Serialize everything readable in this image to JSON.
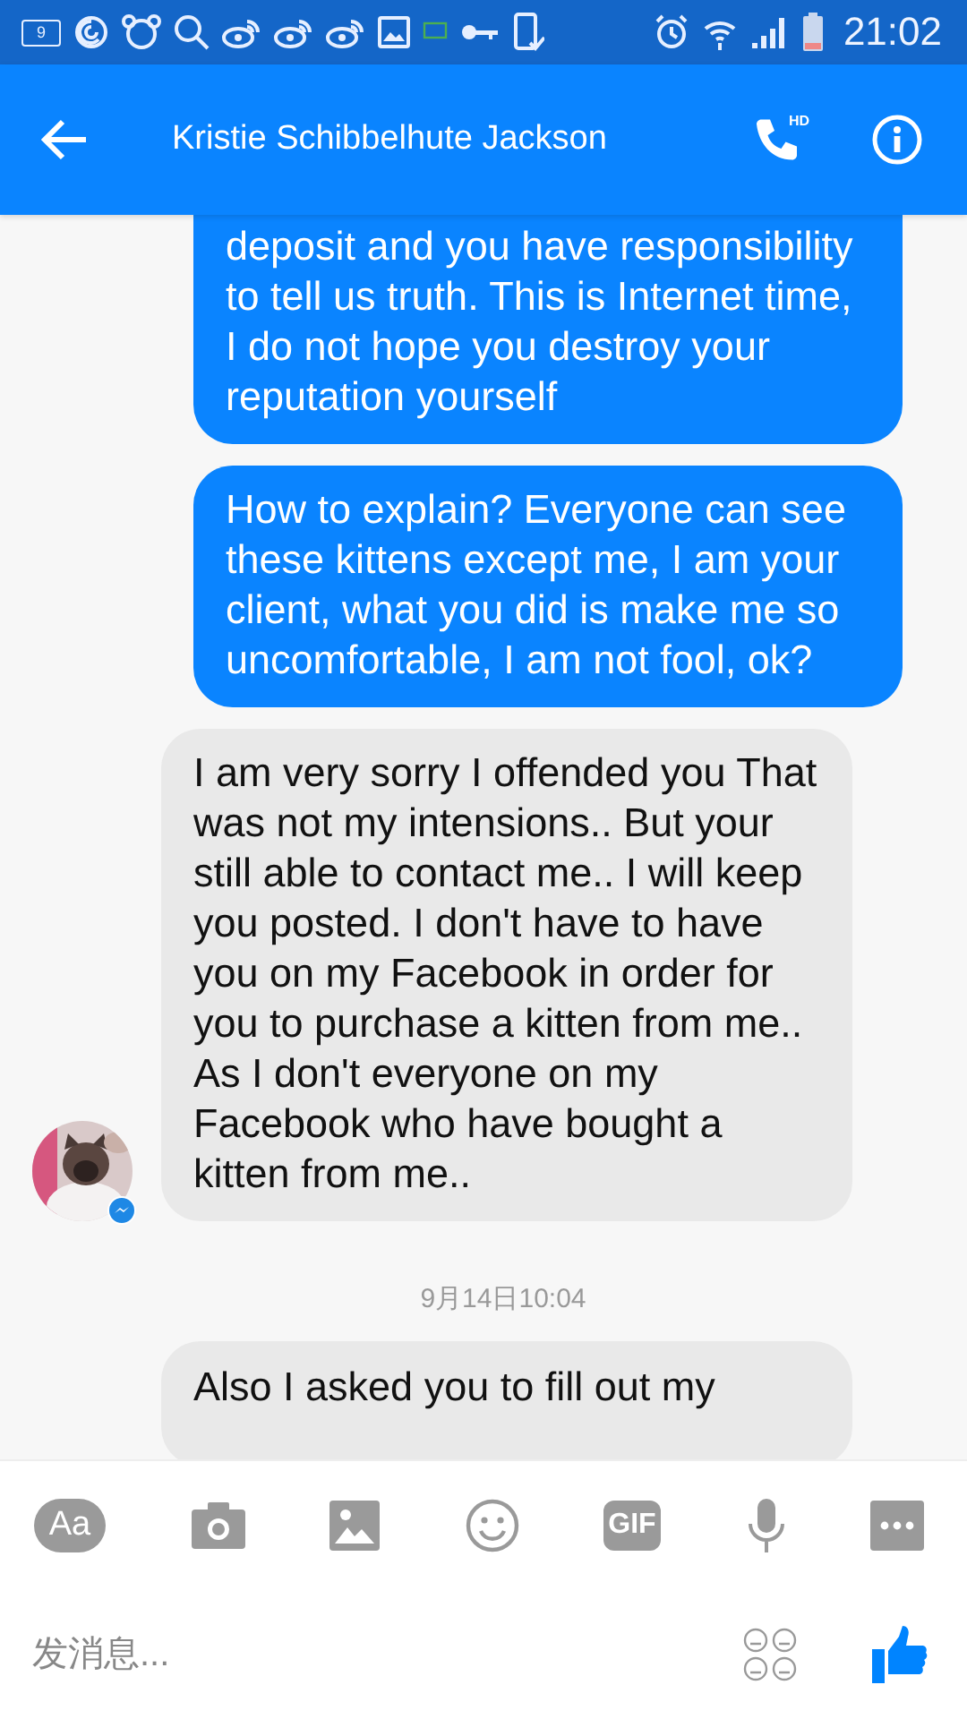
{
  "status_bar": {
    "notification_count": "9",
    "time": "21:02"
  },
  "header": {
    "title": "Kristie Schibbelhute Jackson",
    "call_badge": "HD"
  },
  "messages": [
    {
      "kind": "outgoing",
      "text": "deposit and you have responsibility to tell us truth. This is Internet time, I do not hope you destroy your reputation yourself"
    },
    {
      "kind": "outgoing",
      "text": "How to explain? Everyone can see these kittens except me, I am your client, what you did is make me so uncomfortable, I am not fool, ok?"
    },
    {
      "kind": "incoming",
      "text": "I am very sorry I offended you That was not my intensions.. But your still able to contact me.. I will keep you posted. I don't have to have you on my Facebook in order for you to purchase a kitten from me.. As I don't everyone on my Facebook who have bought a kitten from me..",
      "has_avatar": true
    },
    {
      "kind": "timestamp",
      "text": "9月14日10:04"
    },
    {
      "kind": "incoming",
      "text": "Also I asked you to fill out my",
      "has_avatar": false
    }
  ],
  "toolbar": [
    {
      "kind": "text-style",
      "label": "Aa"
    },
    {
      "kind": "camera"
    },
    {
      "kind": "gallery"
    },
    {
      "kind": "emoji"
    },
    {
      "kind": "gif",
      "label": "GIF"
    },
    {
      "kind": "mic"
    },
    {
      "kind": "more"
    }
  ],
  "composer": {
    "placeholder": "发消息..."
  }
}
